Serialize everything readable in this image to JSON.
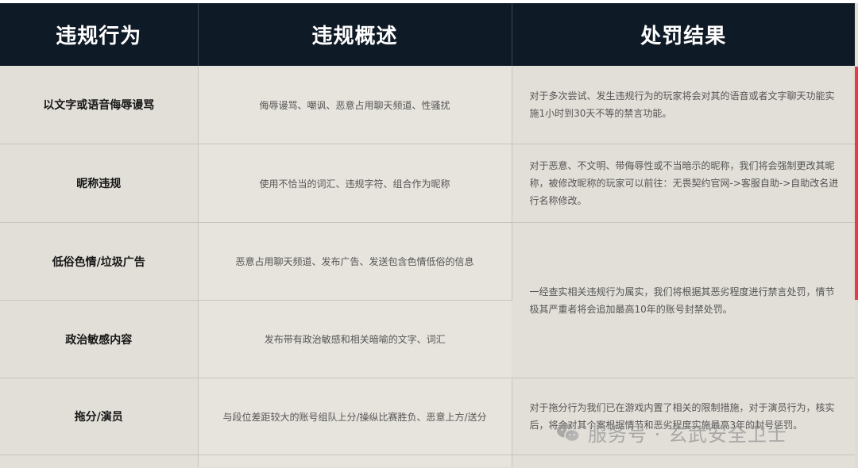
{
  "header": {
    "col1": "违规行为",
    "col2": "违规概述",
    "col3": "处罚结果"
  },
  "rows": [
    {
      "category": "以文字或语音侮辱谩骂",
      "description": "侮辱谩骂、嘲讽、恶意占用聊天频道、性骚扰",
      "penalty": "对于多次尝试、发生违规行为的玩家将会对其的语音或者文字聊天功能实施1小时到30天不等的禁言功能。"
    },
    {
      "category": "昵称违规",
      "description": "使用不恰当的词汇、违规字符、组合作为昵称",
      "penalty": "对于恶意、不文明、带侮辱性或不当暗示的昵称，我们将会强制更改其昵称，被修改昵称的玩家可以前往：无畏契约官网->客服自助->自助改名进行名称修改。"
    },
    {
      "category": "低俗色情/垃圾广告",
      "description": "恶意占用聊天频道、发布广告、发送包含色情低俗的信息",
      "penalty": "一经查实相关违规行为属实，我们将根据其恶劣程度进行禁言处罚，情节极其严重者将会追加最高10年的账号封禁处罚。"
    },
    {
      "category": "政治敏感内容",
      "description": "发布带有政治敏感和相关暗喻的文字、词汇"
    },
    {
      "category": "拖分/演员",
      "description": "与段位差距较大的账号组队上分/操纵比赛胜负、恶意上方/送分",
      "penalty": "对于拖分行为我们已在游戏内置了相关的限制措施，对于演员行为，核实后，将会对其个案根据情节和恶劣程度实施最高3年的封号惩罚。"
    }
  ],
  "watermark": {
    "text": "服务号 · 玄武安全卫士",
    "icon": "wechat-icon"
  }
}
